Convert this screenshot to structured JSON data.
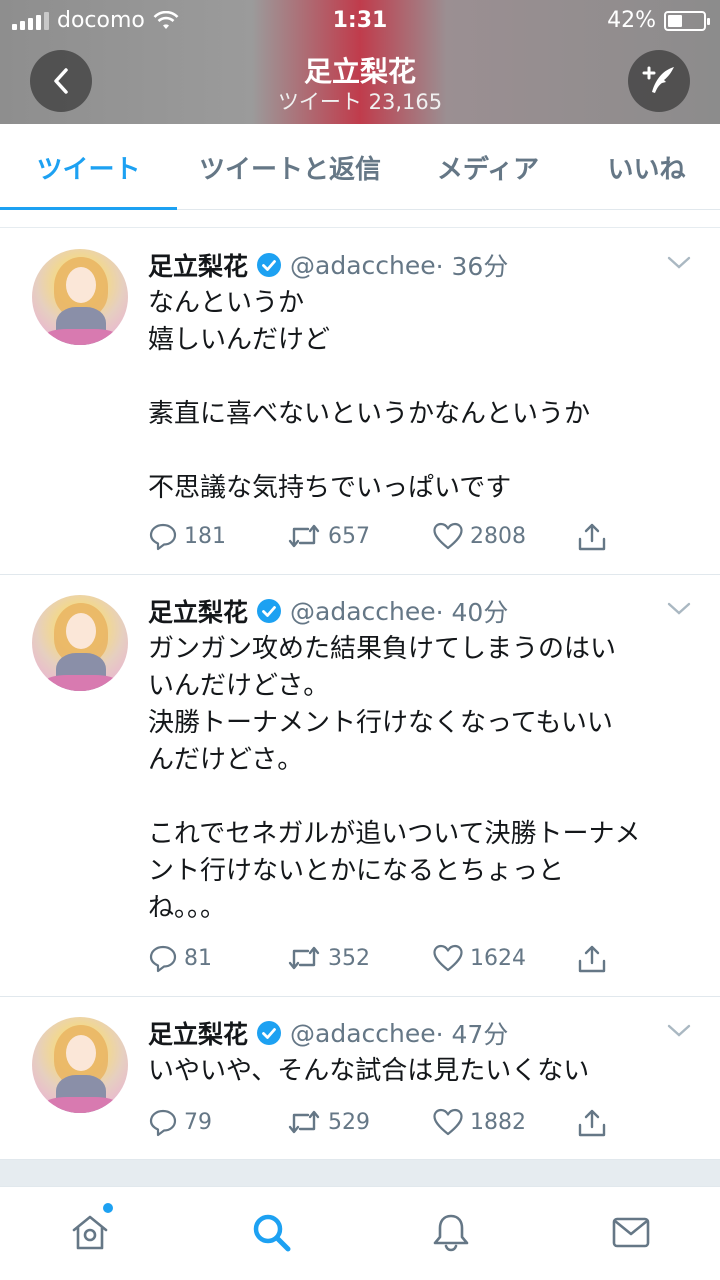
{
  "status_bar": {
    "carrier": "docomo",
    "time": "1:31",
    "battery": "42%",
    "battery_level": 0.42
  },
  "header": {
    "title": "足立梨花",
    "subtitle": "ツイート 23,165"
  },
  "tabs": [
    {
      "label": "ツイート",
      "active": true
    },
    {
      "label": "ツイートと返信",
      "active": false
    },
    {
      "label": "メディア",
      "active": false
    },
    {
      "label": "いいね",
      "active": false
    }
  ],
  "tweets": [
    {
      "name": "足立梨花",
      "handle": "@adacchee",
      "time": "· 36分",
      "text": "なんというか\n嬉しいんだけど\n\n素直に喜べないというかなんというか\n\n不思議な気持ちでいっぱいです",
      "replies": "181",
      "retweets": "657",
      "likes": "2808"
    },
    {
      "name": "足立梨花",
      "handle": "@adacchee",
      "time": "· 40分",
      "text": "ガンガン攻めた結果負けてしまうのはい\nいんだけどさ。\n決勝トーナメント行けなくなってもいい\nんだけどさ。\n\nこれでセネガルが追いついて決勝トーナメ\nント行けないとかになるとちょっと\nね。。。",
      "replies": "81",
      "retweets": "352",
      "likes": "1624"
    },
    {
      "name": "足立梨花",
      "handle": "@adacchee",
      "time": "· 47分",
      "text": "いやいや、そんな試合は見たいくない",
      "replies": "79",
      "retweets": "529",
      "likes": "1882"
    }
  ],
  "colors": {
    "accent": "#1da1f2",
    "muted": "#657786",
    "text": "#14171a"
  },
  "bottom_nav": [
    "home-icon",
    "search-icon",
    "notifications-icon",
    "messages-icon"
  ]
}
